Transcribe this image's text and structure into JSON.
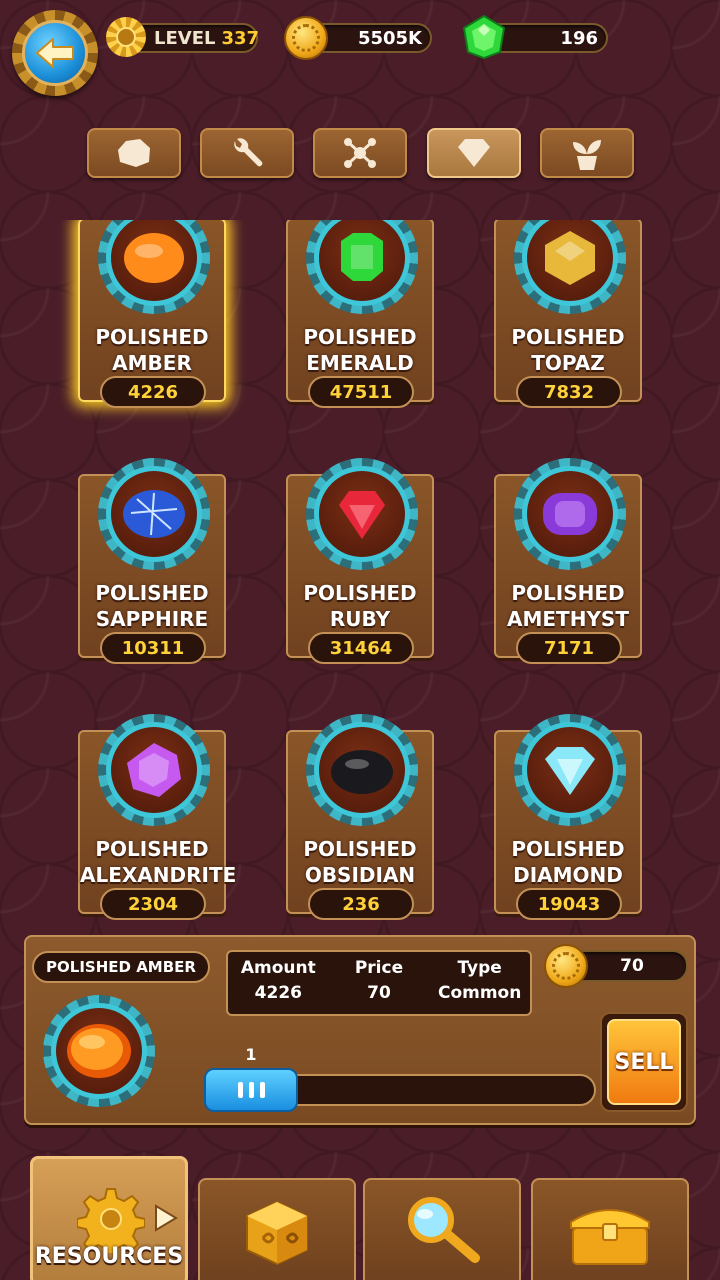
{
  "header": {
    "level_label": "LEVEL",
    "level_value": "337",
    "coins": "5505K",
    "gems": "196"
  },
  "tabs": [
    {
      "icon": "ore-icon",
      "active": false
    },
    {
      "icon": "wrench-icon",
      "active": false
    },
    {
      "icon": "molecule-icon",
      "active": false
    },
    {
      "icon": "diamond-icon",
      "active": true
    },
    {
      "icon": "plant-icon",
      "active": false
    }
  ],
  "items": [
    {
      "line1": "POLISHED",
      "line2": "AMBER",
      "count": "4226",
      "color": "#ff8c1a",
      "selected": true
    },
    {
      "line1": "POLISHED",
      "line2": "EMERALD",
      "count": "47511",
      "color": "#2ed83a",
      "selected": false
    },
    {
      "line1": "POLISHED",
      "line2": "TOPAZ",
      "count": "7832",
      "color": "#e8b83a",
      "selected": false
    },
    {
      "line1": "POLISHED",
      "line2": "SAPPHIRE",
      "count": "10311",
      "color": "#2a5ad8",
      "selected": false
    },
    {
      "line1": "POLISHED",
      "line2": "RUBY",
      "count": "31464",
      "color": "#e8283a",
      "selected": false
    },
    {
      "line1": "POLISHED",
      "line2": "AMETHYST",
      "count": "7171",
      "color": "#8a3ad8",
      "selected": false
    },
    {
      "line1": "POLISHED",
      "line2": "ALEXANDRITE",
      "count": "2304",
      "color": "#c65af0",
      "selected": false
    },
    {
      "line1": "POLISHED",
      "line2": "OBSIDIAN",
      "count": "236",
      "color": "#1a1a1e",
      "selected": false
    },
    {
      "line1": "POLISHED",
      "line2": "DIAMOND",
      "count": "19043",
      "color": "#8ae8f8",
      "selected": false
    }
  ],
  "detail": {
    "name": "POLISHED AMBER",
    "amount_label": "Amount",
    "amount_value": "4226",
    "price_label": "Price",
    "price_value": "70",
    "type_label": "Type",
    "type_value": "Common",
    "total": "70",
    "slider_value": "1",
    "sell_label": "SELL"
  },
  "nav": {
    "resources_label": "RESOURCES"
  }
}
